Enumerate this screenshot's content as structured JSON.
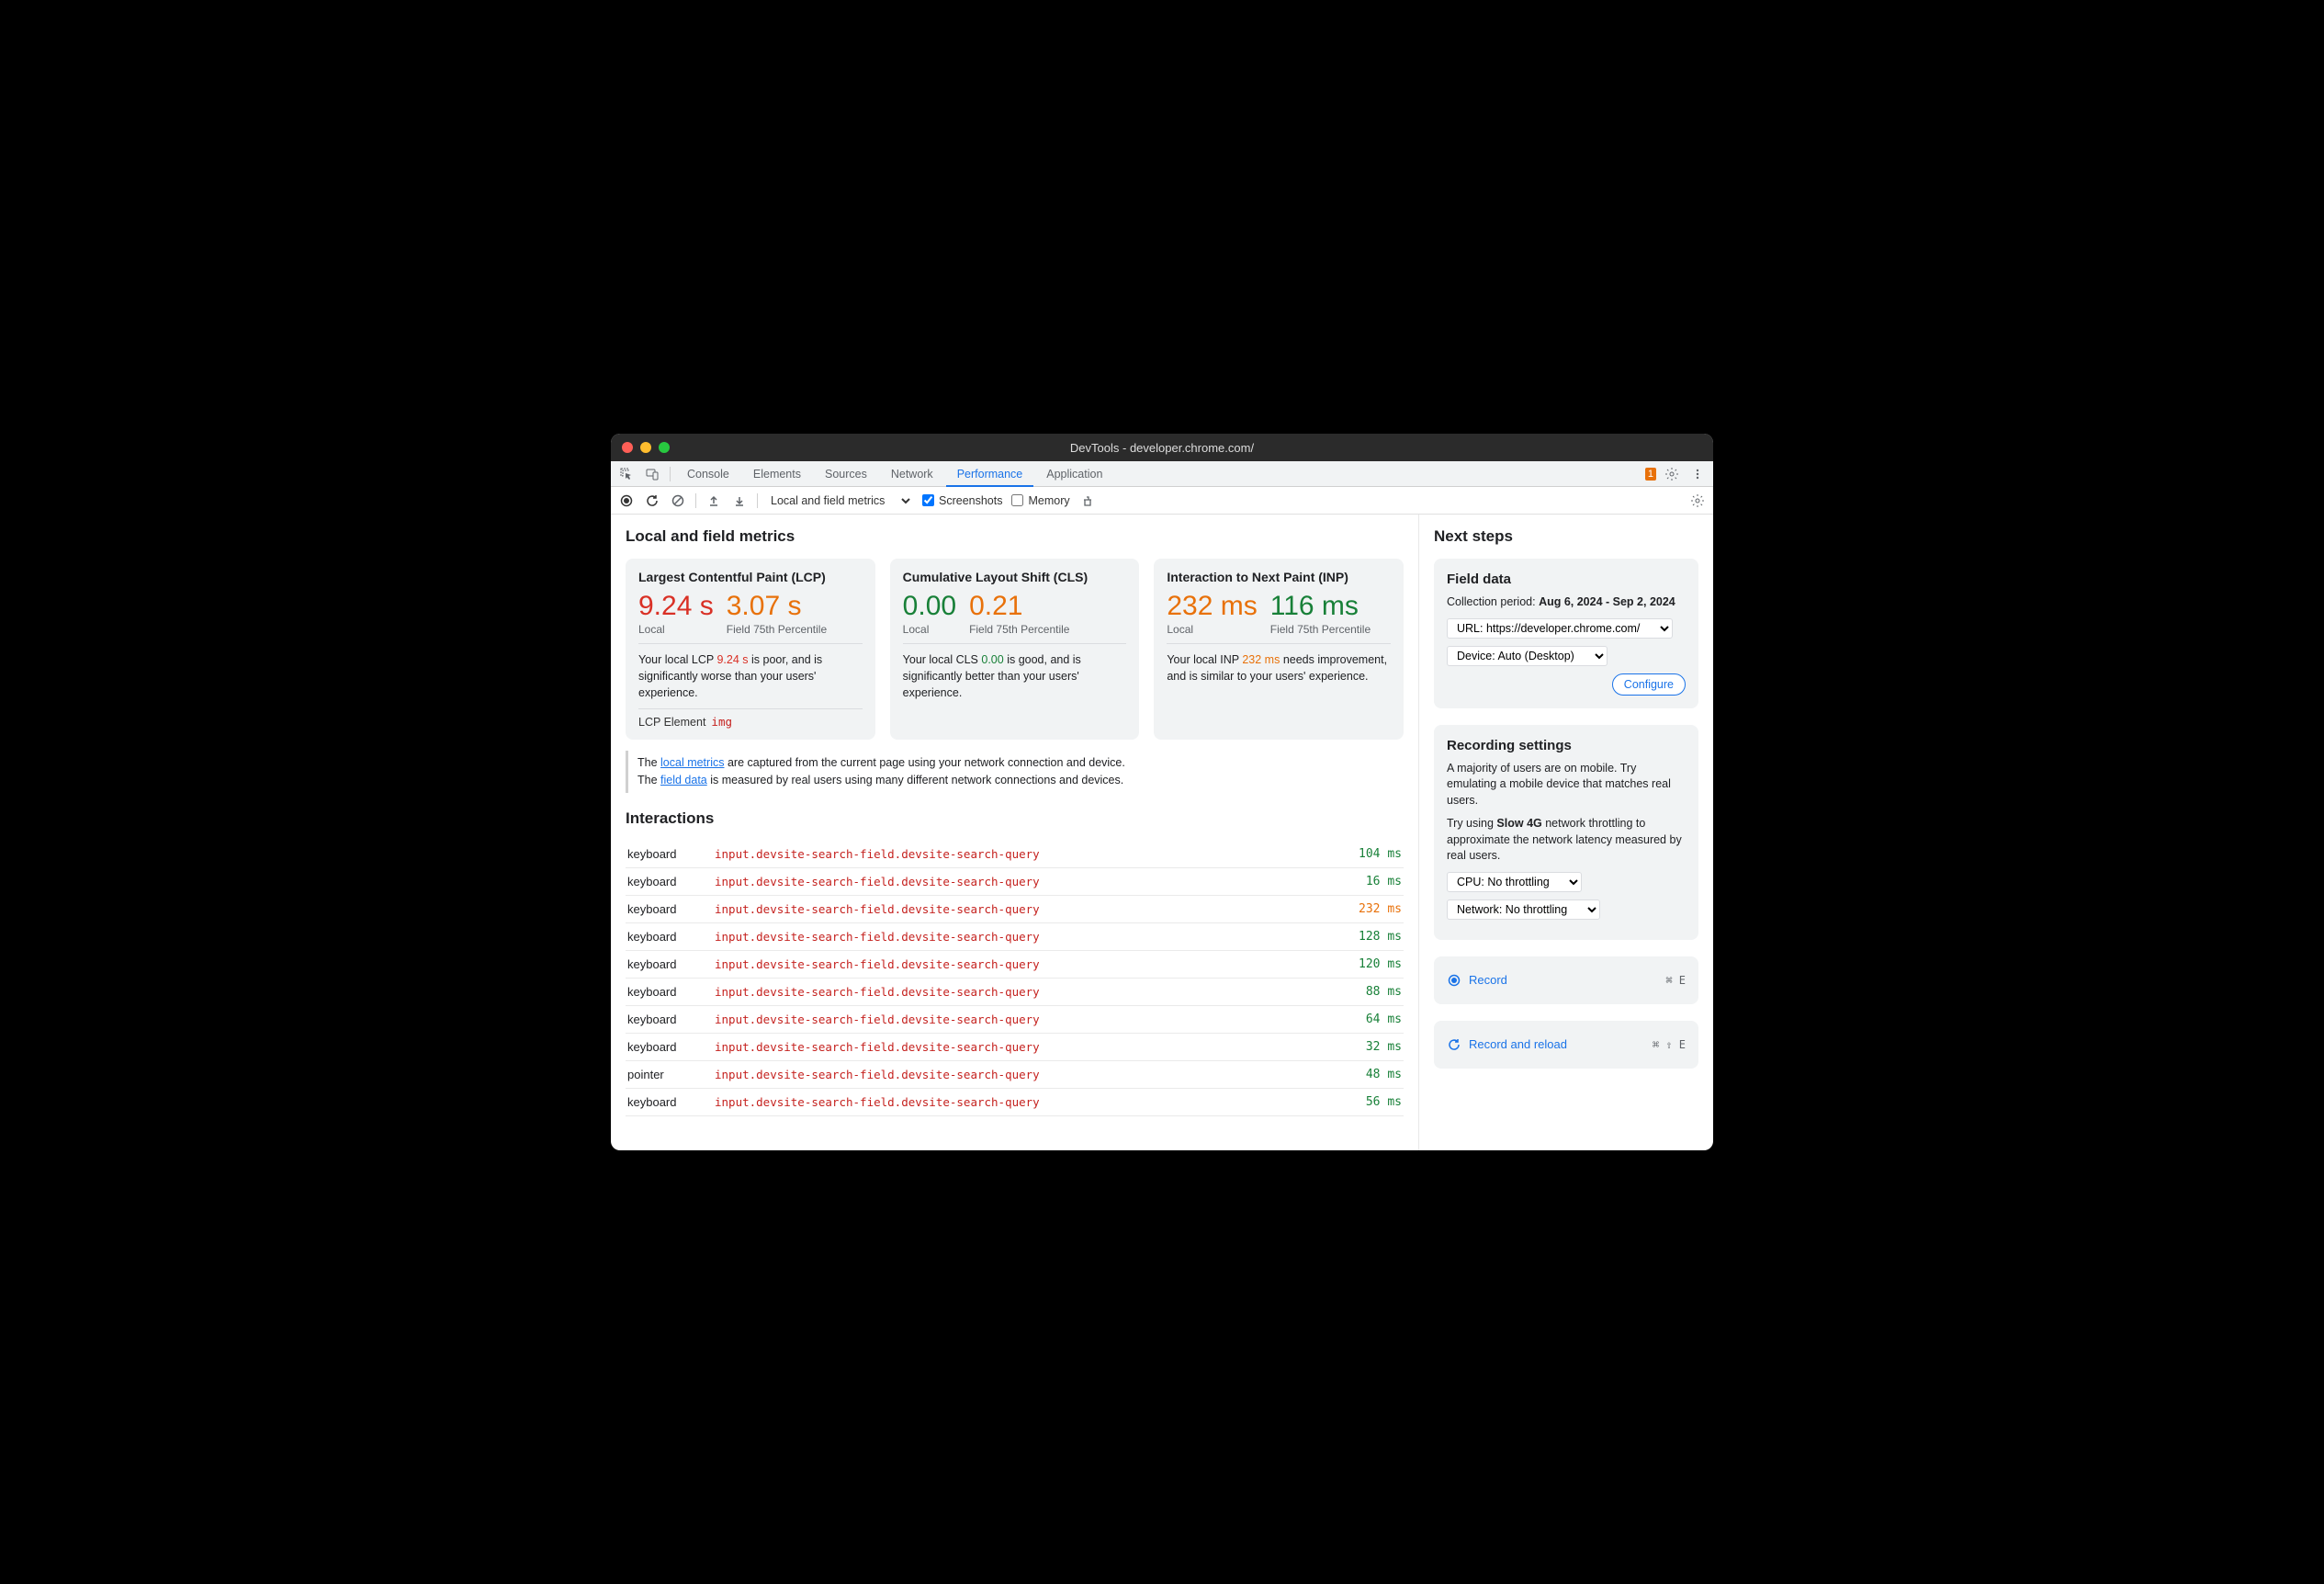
{
  "window": {
    "title": "DevTools - developer.chrome.com/"
  },
  "tabs": {
    "items": [
      "Console",
      "Elements",
      "Sources",
      "Network",
      "Performance",
      "Application"
    ],
    "active": 4,
    "issues_count": "1"
  },
  "toolbar": {
    "dropdown": "Local and field metrics",
    "screenshots_label": "Screenshots",
    "screenshots_checked": true,
    "memory_label": "Memory",
    "memory_checked": false
  },
  "main": {
    "heading": "Local and field metrics",
    "cards": [
      {
        "title": "Largest Contentful Paint (LCP)",
        "local_value": "9.24 s",
        "local_color": "red",
        "local_label": "Local",
        "field_value": "3.07 s",
        "field_color": "orange",
        "field_label": "Field 75th Percentile",
        "desc_pre": "Your local LCP ",
        "desc_val": "9.24 s",
        "desc_val_color": "red",
        "desc_post": " is poor, and is significantly worse than your users' experience.",
        "lcp_element_label": "LCP Element",
        "lcp_element_tag": "img"
      },
      {
        "title": "Cumulative Layout Shift (CLS)",
        "local_value": "0.00",
        "local_color": "green",
        "local_label": "Local",
        "field_value": "0.21",
        "field_color": "orange",
        "field_label": "Field 75th Percentile",
        "desc_pre": "Your local CLS ",
        "desc_val": "0.00",
        "desc_val_color": "green",
        "desc_post": " is good, and is significantly better than your users' experience."
      },
      {
        "title": "Interaction to Next Paint (INP)",
        "local_value": "232 ms",
        "local_color": "orange",
        "local_label": "Local",
        "field_value": "116 ms",
        "field_color": "green",
        "field_label": "Field 75th Percentile",
        "desc_pre": "Your local INP ",
        "desc_val": "232 ms",
        "desc_val_color": "orange",
        "desc_post": " needs improvement, and is similar to your users' experience."
      }
    ],
    "info": {
      "line1_pre": "The ",
      "line1_link": "local metrics",
      "line1_post": " are captured from the current page using your network connection and device.",
      "line2_pre": "The ",
      "line2_link": "field data",
      "line2_post": " is measured by real users using many different network connections and devices."
    },
    "interactions_heading": "Interactions",
    "interactions": [
      {
        "type": "keyboard",
        "selector": "input.devsite-search-field.devsite-search-query",
        "time": "104 ms",
        "time_color": "green"
      },
      {
        "type": "keyboard",
        "selector": "input.devsite-search-field.devsite-search-query",
        "time": "16 ms",
        "time_color": "green"
      },
      {
        "type": "keyboard",
        "selector": "input.devsite-search-field.devsite-search-query",
        "time": "232 ms",
        "time_color": "orange"
      },
      {
        "type": "keyboard",
        "selector": "input.devsite-search-field.devsite-search-query",
        "time": "128 ms",
        "time_color": "green"
      },
      {
        "type": "keyboard",
        "selector": "input.devsite-search-field.devsite-search-query",
        "time": "120 ms",
        "time_color": "green"
      },
      {
        "type": "keyboard",
        "selector": "input.devsite-search-field.devsite-search-query",
        "time": "88 ms",
        "time_color": "green"
      },
      {
        "type": "keyboard",
        "selector": "input.devsite-search-field.devsite-search-query",
        "time": "64 ms",
        "time_color": "green"
      },
      {
        "type": "keyboard",
        "selector": "input.devsite-search-field.devsite-search-query",
        "time": "32 ms",
        "time_color": "green"
      },
      {
        "type": "pointer",
        "selector": "input.devsite-search-field.devsite-search-query",
        "time": "48 ms",
        "time_color": "green"
      },
      {
        "type": "keyboard",
        "selector": "input.devsite-search-field.devsite-search-query",
        "time": "56 ms",
        "time_color": "green"
      }
    ]
  },
  "right": {
    "heading": "Next steps",
    "field_data": {
      "title": "Field data",
      "period_label": "Collection period: ",
      "period_value": "Aug 6, 2024 - Sep 2, 2024",
      "url_select": "URL: https://developer.chrome.com/",
      "device_select": "Device: Auto (Desktop)",
      "configure_label": "Configure"
    },
    "recording": {
      "title": "Recording settings",
      "para1_pre": "A majority of users are on mobile. Try emulating a mobile device that matches real users.",
      "para2_pre": "Try using ",
      "para2_bold": "Slow 4G",
      "para2_post": " network throttling to approximate the network latency measured by real users.",
      "cpu_select": "CPU: No throttling",
      "network_select": "Network: No throttling"
    },
    "record": {
      "label": "Record",
      "shortcut": "⌘ E"
    },
    "record_reload": {
      "label": "Record and reload",
      "shortcut": "⌘ ⇧ E"
    }
  }
}
